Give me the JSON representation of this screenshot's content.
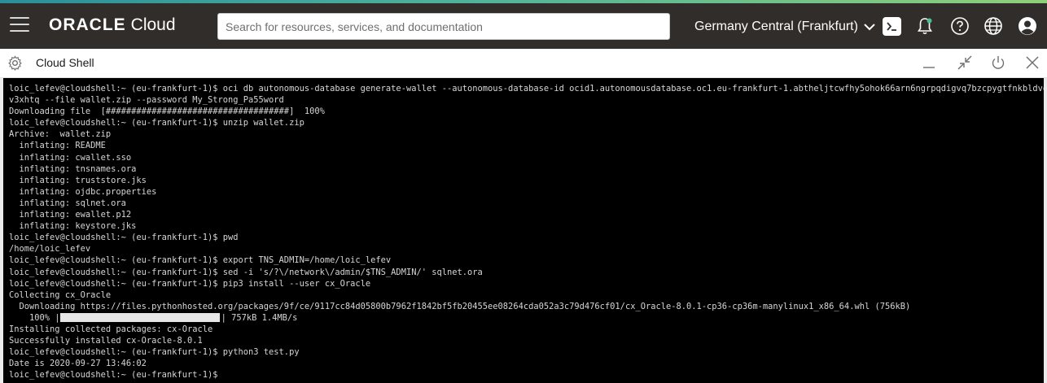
{
  "header": {
    "brand": "ORACLE",
    "product": "Cloud",
    "search_placeholder": "Search for resources, services, and documentation",
    "region": "Germany Central (Frankfurt)",
    "icons": [
      "menu-icon",
      "cloud-shell-icon",
      "bell-icon",
      "help-icon",
      "globe-icon",
      "user-icon"
    ],
    "accent_colors": [
      "#2a8f9a",
      "#8fcf7a"
    ]
  },
  "shell": {
    "title": "Cloud Shell",
    "icons": [
      "gear-icon",
      "minimize-icon",
      "restore-icon",
      "power-icon",
      "close-icon"
    ]
  },
  "terminal": {
    "lines": [
      "loic_lefev@cloudshell:~ (eu-frankfurt-1)$ oci db autonomous-database generate-wallet --autonomous-database-id ocid1.autonomousdatabase.oc1.eu-frankfurt-1.abtheljtcwfhy5ohok66arn6ngrpqdigvq7bzcpygtfnkbldvgtk4r",
      "v3xhtq --file wallet.zip --password My_Strong_Pa55word",
      "Downloading file  [####################################]  100%",
      "loic_lefev@cloudshell:~ (eu-frankfurt-1)$ unzip wallet.zip",
      "Archive:  wallet.zip",
      "  inflating: README",
      "  inflating: cwallet.sso",
      "  inflating: tnsnames.ora",
      "  inflating: truststore.jks",
      "  inflating: ojdbc.properties",
      "  inflating: sqlnet.ora",
      "  inflating: ewallet.p12",
      "  inflating: keystore.jks",
      "loic_lefev@cloudshell:~ (eu-frankfurt-1)$ pwd",
      "/home/loic_lefev",
      "loic_lefev@cloudshell:~ (eu-frankfurt-1)$ export TNS_ADMIN=/home/loic_lefev",
      "loic_lefev@cloudshell:~ (eu-frankfurt-1)$ sed -i 's/?\\/network\\/admin/$TNS_ADMIN/' sqlnet.ora",
      "loic_lefev@cloudshell:~ (eu-frankfurt-1)$ pip3 install --user cx_Oracle",
      "Collecting cx_Oracle",
      "  Downloading https://files.pythonhosted.org/packages/9f/ce/9117cc84d05800b7962f1842bf5fb20455ee08264cda052a3c79d476cf01/cx_Oracle-8.0.1-cp36-cp36m-manylinux1_x86_64.whl (756kB)"
    ],
    "progress": {
      "prefix": "    100% |",
      "suffix": "| 757kB 1.4MB/s",
      "fraction": 1.0
    },
    "lines_after": [
      "Installing collected packages: cx-Oracle",
      "Successfully installed cx-Oracle-8.0.1",
      "loic_lefev@cloudshell:~ (eu-frankfurt-1)$ python3 test.py",
      "Date is 2020-09-27 13:46:02",
      "loic_lefev@cloudshell:~ (eu-frankfurt-1)$"
    ]
  }
}
